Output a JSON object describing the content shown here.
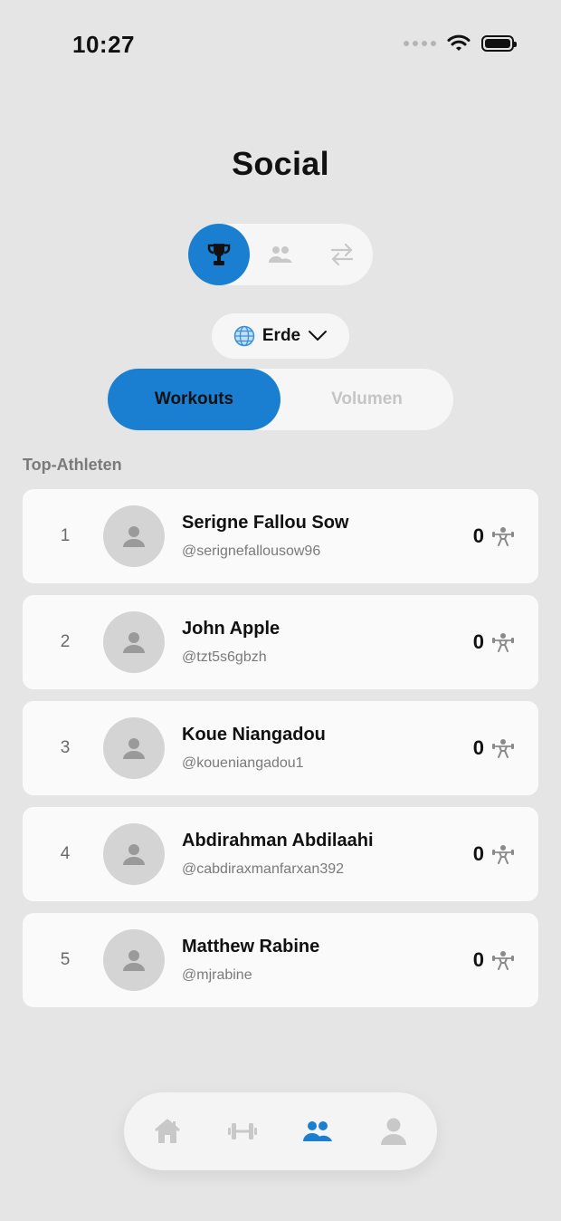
{
  "status_bar": {
    "time": "10:27"
  },
  "header": {
    "title": "Social"
  },
  "view_switch": {
    "items": [
      {
        "icon": "trophy-icon",
        "active": true
      },
      {
        "icon": "people-icon",
        "active": false
      },
      {
        "icon": "swap-arrows-icon",
        "active": false
      }
    ]
  },
  "region": {
    "icon": "globe-icon",
    "label": "Erde"
  },
  "tabs": {
    "active": "Workouts",
    "inactive": "Volumen"
  },
  "section": {
    "label": "Top-Athleten"
  },
  "athletes": [
    {
      "rank": "1",
      "name": "Serigne Fallou Sow",
      "handle": "@serignefallousow96",
      "score": "0"
    },
    {
      "rank": "2",
      "name": "John Apple",
      "handle": "@tzt5s6gbzh",
      "score": "0"
    },
    {
      "rank": "3",
      "name": "Koue Niangadou",
      "handle": "@koueniangadou1",
      "score": "0"
    },
    {
      "rank": "4",
      "name": "Abdirahman Abdilaahi",
      "handle": "@cabdiraxmanfarxan392",
      "score": "0"
    },
    {
      "rank": "5",
      "name": "Matthew Rabine",
      "handle": "@mjrabine",
      "score": "0"
    }
  ],
  "bottom_nav": [
    {
      "icon": "home-icon",
      "active": false
    },
    {
      "icon": "dumbbell-icon",
      "active": false
    },
    {
      "icon": "people-icon",
      "active": true
    },
    {
      "icon": "profile-icon",
      "active": false
    }
  ],
  "colors": {
    "accent": "#1a7fd0",
    "background": "#e5e5e5",
    "card": "#fafafa",
    "muted": "#7a7a7a"
  }
}
